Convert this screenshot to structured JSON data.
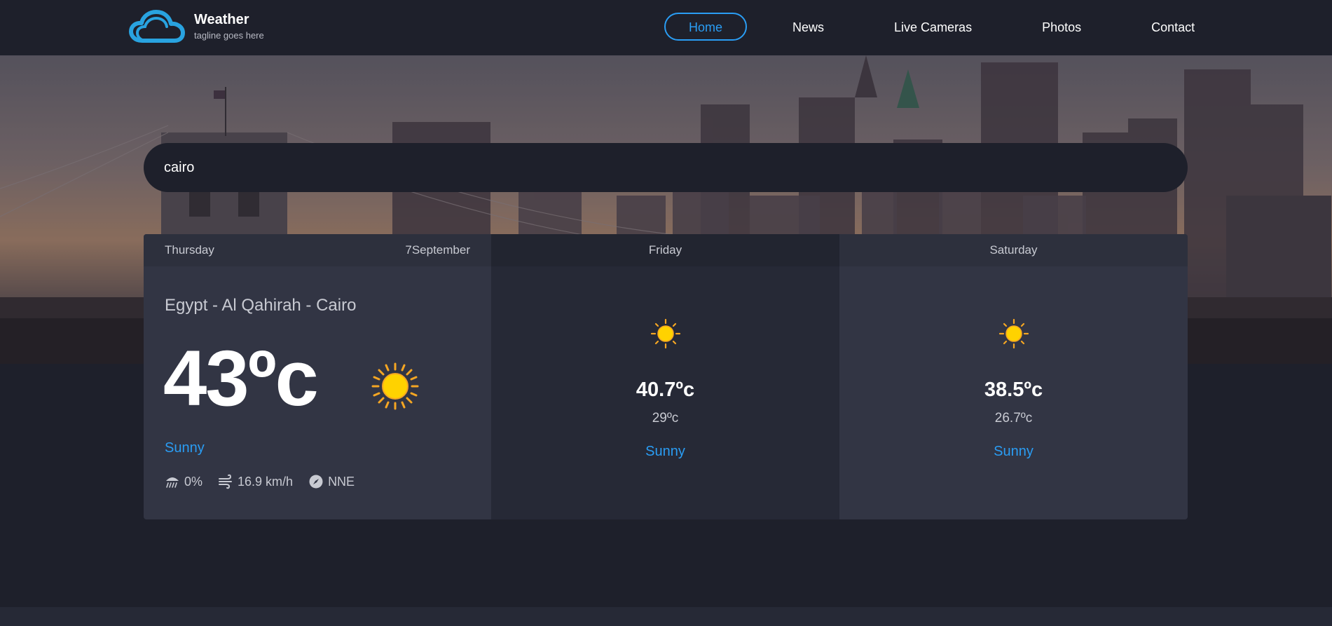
{
  "brand": {
    "title": "Weather",
    "tagline": "tagline goes here"
  },
  "nav": [
    {
      "label": "Home",
      "active": true
    },
    {
      "label": "News",
      "active": false
    },
    {
      "label": "Live Cameras",
      "active": false
    },
    {
      "label": "Photos",
      "active": false
    },
    {
      "label": "Contact",
      "active": false
    }
  ],
  "search": {
    "value": "cairo"
  },
  "today": {
    "day": "Thursday",
    "date": "7September",
    "location": "Egypt - Al Qahirah - Cairo",
    "temp": "43ºc",
    "condition": "Sunny",
    "icon": "sun-icon",
    "rain": "0%",
    "wind": "16.9 km/h",
    "direction": "NNE"
  },
  "days": [
    {
      "day": "Friday",
      "max": "40.7ºc",
      "min": "29ºc",
      "condition": "Sunny",
      "icon": "sun-icon"
    },
    {
      "day": "Saturday",
      "max": "38.5ºc",
      "min": "26.7ºc",
      "condition": "Sunny",
      "icon": "sun-icon"
    }
  ],
  "colors": {
    "accent": "#2a9df4",
    "background": "#1e202b",
    "card": "#323544",
    "card_dark": "#262936"
  }
}
